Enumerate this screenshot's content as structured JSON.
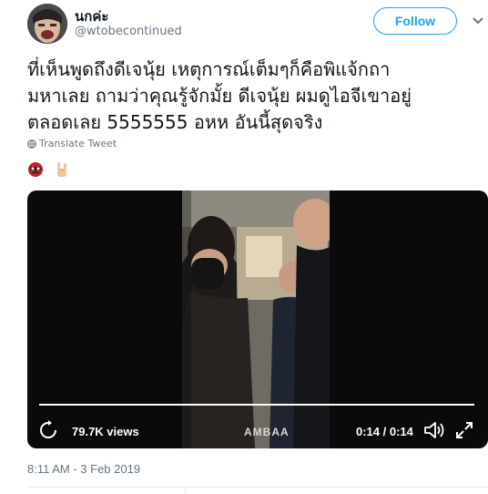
{
  "user": {
    "display_name": "นกค่ะ",
    "handle": "@wtobecontinued",
    "avatar_icon": "avatar-photo"
  },
  "actions": {
    "follow_label": "Follow",
    "menu_icon": "chevron-down-icon"
  },
  "tweet": {
    "lines": [
      "ที่เห็นพูดถึงดีเจนุ้ย เหตุการณ์เต็มๆก็คือพิแจ้กถา",
      "มหาเลย ถามว่าคุณรู้จักมั้ย ดีเจนุ้ย ผมดูไอจีเขาอยู่",
      "ตลอดเลย 5555555 อหห อันนี้สุดจริง"
    ],
    "translate_label": "Translate Tweet",
    "emojis": [
      "red-mask-emoji",
      "sign-of-horns-emoji"
    ]
  },
  "video": {
    "views": "79.7K views",
    "watermark": "AMBAA",
    "time": "0:14 / 0:14",
    "progress_fraction": 1.0
  },
  "meta": {
    "timestamp": "8:11 AM - 3 Feb 2019"
  },
  "colors": {
    "accent": "#1da1f2",
    "secondary_text": "#657786",
    "video_bg": "#0a0a0a"
  }
}
